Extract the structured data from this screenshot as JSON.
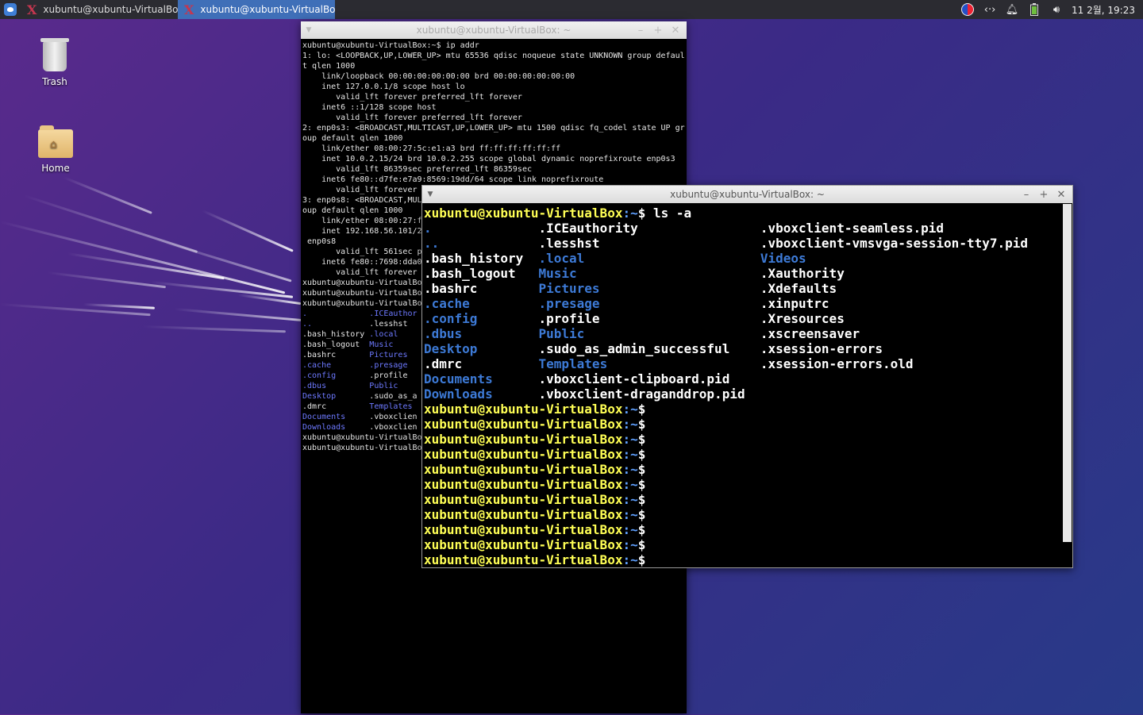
{
  "panel": {
    "tasks": [
      {
        "label": "xubuntu@xubuntu-VirtualBo...",
        "active": false
      },
      {
        "label": "xubuntu@xubuntu-VirtualBo...",
        "active": true
      }
    ],
    "clock": "11 2월, 19:23",
    "tray_icons": [
      "keyboard-layout-icon",
      "network-icon",
      "notification-bell-icon",
      "battery-icon",
      "volume-icon"
    ]
  },
  "desktop": {
    "icons": [
      {
        "label": "Trash",
        "icon": "trash-icon"
      },
      {
        "label": "Home",
        "icon": "home-folder-icon"
      }
    ]
  },
  "window1": {
    "title": "xubuntu@xubuntu-VirtualBox: ~",
    "lines": [
      "xubuntu@xubuntu-VirtualBox:~$ ip addr",
      "1: lo: <LOOPBACK,UP,LOWER_UP> mtu 65536 qdisc noqueue state UNKNOWN group defaul",
      "t qlen 1000",
      "    link/loopback 00:00:00:00:00:00 brd 00:00:00:00:00:00",
      "    inet 127.0.0.1/8 scope host lo",
      "       valid_lft forever preferred_lft forever",
      "    inet6 ::1/128 scope host",
      "       valid_lft forever preferred_lft forever",
      "2: enp0s3: <BROADCAST,MULTICAST,UP,LOWER_UP> mtu 1500 qdisc fq_codel state UP gr",
      "oup default qlen 1000",
      "    link/ether 08:00:27:5c:e1:a3 brd ff:ff:ff:ff:ff:ff",
      "    inet 10.0.2.15/24 brd 10.0.2.255 scope global dynamic noprefixroute enp0s3",
      "       valid_lft 86359sec preferred_lft 86359sec",
      "    inet6 fe80::d7fe:e7a9:8569:19dd/64 scope link noprefixroute",
      "       valid_lft forever",
      "3: enp0s8: <BROADCAST,MUL",
      "oup default qlen 1000",
      "    link/ether 08:00:27:f",
      "    inet 192.168.56.101/2",
      " enp0s8",
      "       valid_lft 561sec p",
      "    inet6 fe80::7698:dda0",
      "       valid_lft forever",
      "xubuntu@xubuntu-VirtualBo",
      "xubuntu@xubuntu-VirtualBo",
      "xubuntu@xubuntu-VirtualBo"
    ],
    "ls_rows": [
      [
        ".",
        ".ICEauthor"
      ],
      [
        "..",
        ".lesshst"
      ],
      [
        ".bash_history",
        ".local"
      ],
      [
        ".bash_logout",
        "Music"
      ],
      [
        ".bashrc",
        "Pictures"
      ],
      [
        ".cache",
        ".presage"
      ],
      [
        ".config",
        ".profile"
      ],
      [
        ".dbus",
        "Public"
      ],
      [
        "Desktop",
        ".sudo_as_a"
      ],
      [
        ".dmrc",
        "Templates"
      ],
      [
        "Documents",
        ".vboxclien"
      ],
      [
        "Downloads",
        ".vboxclien"
      ]
    ],
    "tail": [
      "xubuntu@xubuntu-VirtualBo",
      "xubuntu@xubuntu-VirtualBo"
    ]
  },
  "window2": {
    "title": "xubuntu@xubuntu-VirtualBox: ~",
    "prompt_user": "xubuntu@xubuntu-VirtualBox",
    "prompt_path": ":~",
    "prompt_sign": "$",
    "command": "ls -a",
    "ls_columns": [
      [
        ".",
        "..",
        ".bash_history",
        ".bash_logout",
        ".bashrc",
        ".cache",
        ".config",
        ".dbus",
        "Desktop",
        ".dmrc",
        "Documents",
        "Downloads"
      ],
      [
        ".ICEauthority",
        ".lesshst",
        ".local",
        "Music",
        "Pictures",
        ".presage",
        ".profile",
        "Public",
        ".sudo_as_admin_successful",
        "Templates",
        ".vboxclient-clipboard.pid",
        ".vboxclient-draganddrop.pid"
      ],
      [
        ".vboxclient-seamless.pid",
        ".vboxclient-vmsvga-session-tty7.pid",
        "Videos",
        ".Xauthority",
        ".Xdefaults",
        ".xinputrc",
        ".Xresources",
        ".xscreensaver",
        ".xsession-errors",
        ".xsession-errors.old"
      ]
    ],
    "directories": [
      ".",
      "..",
      ".cache",
      ".config",
      ".dbus",
      "Desktop",
      "Documents",
      "Downloads",
      ".local",
      "Music",
      "Pictures",
      ".presage",
      "Public",
      "Templates",
      "Videos",
      ".ICEauthor"
    ],
    "empty_prompts": 11
  },
  "colors": {
    "prompt": "#ffff55",
    "directory": "#3d7ad6",
    "panel_active": "#3f6fb8"
  }
}
